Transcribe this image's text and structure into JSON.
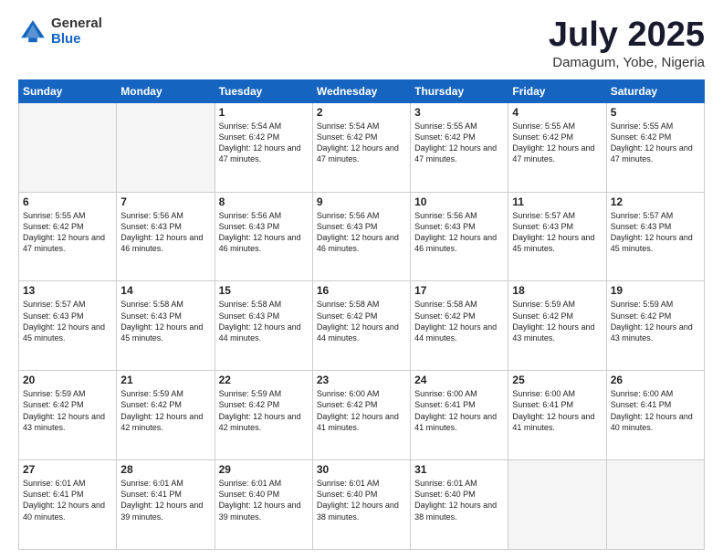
{
  "logo": {
    "general": "General",
    "blue": "Blue"
  },
  "title": "July 2025",
  "location": "Damagum, Yobe, Nigeria",
  "headers": [
    "Sunday",
    "Monday",
    "Tuesday",
    "Wednesday",
    "Thursday",
    "Friday",
    "Saturday"
  ],
  "rows": [
    [
      {
        "day": "",
        "empty": true
      },
      {
        "day": "",
        "empty": true
      },
      {
        "day": "1",
        "sunrise": "Sunrise: 5:54 AM",
        "sunset": "Sunset: 6:42 PM",
        "daylight": "Daylight: 12 hours and 47 minutes."
      },
      {
        "day": "2",
        "sunrise": "Sunrise: 5:54 AM",
        "sunset": "Sunset: 6:42 PM",
        "daylight": "Daylight: 12 hours and 47 minutes."
      },
      {
        "day": "3",
        "sunrise": "Sunrise: 5:55 AM",
        "sunset": "Sunset: 6:42 PM",
        "daylight": "Daylight: 12 hours and 47 minutes."
      },
      {
        "day": "4",
        "sunrise": "Sunrise: 5:55 AM",
        "sunset": "Sunset: 6:42 PM",
        "daylight": "Daylight: 12 hours and 47 minutes."
      },
      {
        "day": "5",
        "sunrise": "Sunrise: 5:55 AM",
        "sunset": "Sunset: 6:42 PM",
        "daylight": "Daylight: 12 hours and 47 minutes."
      }
    ],
    [
      {
        "day": "6",
        "sunrise": "Sunrise: 5:55 AM",
        "sunset": "Sunset: 6:42 PM",
        "daylight": "Daylight: 12 hours and 47 minutes."
      },
      {
        "day": "7",
        "sunrise": "Sunrise: 5:56 AM",
        "sunset": "Sunset: 6:43 PM",
        "daylight": "Daylight: 12 hours and 46 minutes."
      },
      {
        "day": "8",
        "sunrise": "Sunrise: 5:56 AM",
        "sunset": "Sunset: 6:43 PM",
        "daylight": "Daylight: 12 hours and 46 minutes."
      },
      {
        "day": "9",
        "sunrise": "Sunrise: 5:56 AM",
        "sunset": "Sunset: 6:43 PM",
        "daylight": "Daylight: 12 hours and 46 minutes."
      },
      {
        "day": "10",
        "sunrise": "Sunrise: 5:56 AM",
        "sunset": "Sunset: 6:43 PM",
        "daylight": "Daylight: 12 hours and 46 minutes."
      },
      {
        "day": "11",
        "sunrise": "Sunrise: 5:57 AM",
        "sunset": "Sunset: 6:43 PM",
        "daylight": "Daylight: 12 hours and 45 minutes."
      },
      {
        "day": "12",
        "sunrise": "Sunrise: 5:57 AM",
        "sunset": "Sunset: 6:43 PM",
        "daylight": "Daylight: 12 hours and 45 minutes."
      }
    ],
    [
      {
        "day": "13",
        "sunrise": "Sunrise: 5:57 AM",
        "sunset": "Sunset: 6:43 PM",
        "daylight": "Daylight: 12 hours and 45 minutes."
      },
      {
        "day": "14",
        "sunrise": "Sunrise: 5:58 AM",
        "sunset": "Sunset: 6:43 PM",
        "daylight": "Daylight: 12 hours and 45 minutes."
      },
      {
        "day": "15",
        "sunrise": "Sunrise: 5:58 AM",
        "sunset": "Sunset: 6:43 PM",
        "daylight": "Daylight: 12 hours and 44 minutes."
      },
      {
        "day": "16",
        "sunrise": "Sunrise: 5:58 AM",
        "sunset": "Sunset: 6:42 PM",
        "daylight": "Daylight: 12 hours and 44 minutes."
      },
      {
        "day": "17",
        "sunrise": "Sunrise: 5:58 AM",
        "sunset": "Sunset: 6:42 PM",
        "daylight": "Daylight: 12 hours and 44 minutes."
      },
      {
        "day": "18",
        "sunrise": "Sunrise: 5:59 AM",
        "sunset": "Sunset: 6:42 PM",
        "daylight": "Daylight: 12 hours and 43 minutes."
      },
      {
        "day": "19",
        "sunrise": "Sunrise: 5:59 AM",
        "sunset": "Sunset: 6:42 PM",
        "daylight": "Daylight: 12 hours and 43 minutes."
      }
    ],
    [
      {
        "day": "20",
        "sunrise": "Sunrise: 5:59 AM",
        "sunset": "Sunset: 6:42 PM",
        "daylight": "Daylight: 12 hours and 43 minutes."
      },
      {
        "day": "21",
        "sunrise": "Sunrise: 5:59 AM",
        "sunset": "Sunset: 6:42 PM",
        "daylight": "Daylight: 12 hours and 42 minutes."
      },
      {
        "day": "22",
        "sunrise": "Sunrise: 5:59 AM",
        "sunset": "Sunset: 6:42 PM",
        "daylight": "Daylight: 12 hours and 42 minutes."
      },
      {
        "day": "23",
        "sunrise": "Sunrise: 6:00 AM",
        "sunset": "Sunset: 6:42 PM",
        "daylight": "Daylight: 12 hours and 41 minutes."
      },
      {
        "day": "24",
        "sunrise": "Sunrise: 6:00 AM",
        "sunset": "Sunset: 6:41 PM",
        "daylight": "Daylight: 12 hours and 41 minutes."
      },
      {
        "day": "25",
        "sunrise": "Sunrise: 6:00 AM",
        "sunset": "Sunset: 6:41 PM",
        "daylight": "Daylight: 12 hours and 41 minutes."
      },
      {
        "day": "26",
        "sunrise": "Sunrise: 6:00 AM",
        "sunset": "Sunset: 6:41 PM",
        "daylight": "Daylight: 12 hours and 40 minutes."
      }
    ],
    [
      {
        "day": "27",
        "sunrise": "Sunrise: 6:01 AM",
        "sunset": "Sunset: 6:41 PM",
        "daylight": "Daylight: 12 hours and 40 minutes."
      },
      {
        "day": "28",
        "sunrise": "Sunrise: 6:01 AM",
        "sunset": "Sunset: 6:41 PM",
        "daylight": "Daylight: 12 hours and 39 minutes."
      },
      {
        "day": "29",
        "sunrise": "Sunrise: 6:01 AM",
        "sunset": "Sunset: 6:40 PM",
        "daylight": "Daylight: 12 hours and 39 minutes."
      },
      {
        "day": "30",
        "sunrise": "Sunrise: 6:01 AM",
        "sunset": "Sunset: 6:40 PM",
        "daylight": "Daylight: 12 hours and 38 minutes."
      },
      {
        "day": "31",
        "sunrise": "Sunrise: 6:01 AM",
        "sunset": "Sunset: 6:40 PM",
        "daylight": "Daylight: 12 hours and 38 minutes."
      },
      {
        "day": "",
        "empty": true
      },
      {
        "day": "",
        "empty": true
      }
    ]
  ]
}
